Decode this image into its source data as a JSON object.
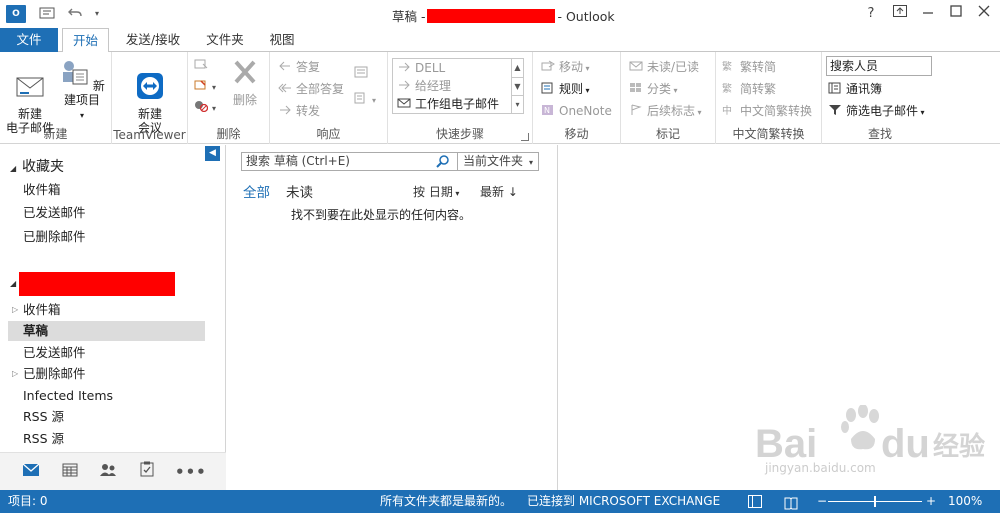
{
  "window": {
    "title_prefix": "草稿 -",
    "title_suffix": "- Outlook",
    "app_icon_text": "O"
  },
  "tabs": [
    {
      "label": "文件"
    },
    {
      "label": "开始"
    },
    {
      "label": "发送/接收"
    },
    {
      "label": "文件夹"
    },
    {
      "label": "视图"
    }
  ],
  "ribbon": {
    "new_group": {
      "new_email": "新建\n电子邮件",
      "new_items": "新建项目",
      "label": "新建"
    },
    "teamviewer_group": {
      "new_meeting": "新建\n会议",
      "label": "TeamViewer"
    },
    "delete_group": {
      "delete": "删除",
      "label": "删除"
    },
    "respond_group": {
      "reply": "答复",
      "reply_all": "全部答复",
      "forward": "转发",
      "label": "响应"
    },
    "quicksteps_group": {
      "items": [
        "DELL",
        "给经理",
        "工作组电子邮件"
      ],
      "label": "快速步骤"
    },
    "move_group": {
      "move": "移动",
      "rules": "规则",
      "onenote": "OneNote",
      "label": "移动"
    },
    "tags_group": {
      "unread_read": "未读/已读",
      "categorize": "分类",
      "follow_up": "后续标志",
      "label": "标记"
    },
    "convert_group": {
      "to_traditional": "繁转简",
      "to_simplified": "简转繁",
      "convert": "中文简繁转换",
      "label": "中文简繁转换"
    },
    "find_group": {
      "search_people": "搜索人员",
      "address_book": "通讯簿",
      "filter_email": "筛选电子邮件",
      "label": "查找"
    }
  },
  "folder_pane": {
    "favorites_header": "收藏夹",
    "favorites": [
      "收件箱",
      "已发送邮件",
      "已删除邮件"
    ],
    "account_folders": [
      "收件箱",
      "草稿",
      "已发送邮件",
      "已删除邮件",
      "Infected Items",
      "RSS 源",
      "RSS 源"
    ],
    "selected_folder": "草稿"
  },
  "message_list": {
    "search_placeholder": "搜索 草稿 (Ctrl+E)",
    "scope": "当前文件夹",
    "filter_all": "全部",
    "filter_unread": "未读",
    "sort_by": "按 日期",
    "sort_order": "最新 ↓",
    "empty_message": "找不到要在此处显示的任何内容。"
  },
  "status_bar": {
    "items": "项目: 0",
    "sync_status": "所有文件夹都是最新的。",
    "connection": "已连接到 MICROSOFT EXCHANGE",
    "zoom_level": "100%",
    "zoom_fraction": 0.5
  },
  "watermark": {
    "logo_text": "Bai du 经验",
    "url": "jingyan.baidu.com"
  },
  "colors": {
    "accent": "#1e6fb5",
    "redaction": "#ff0000"
  }
}
